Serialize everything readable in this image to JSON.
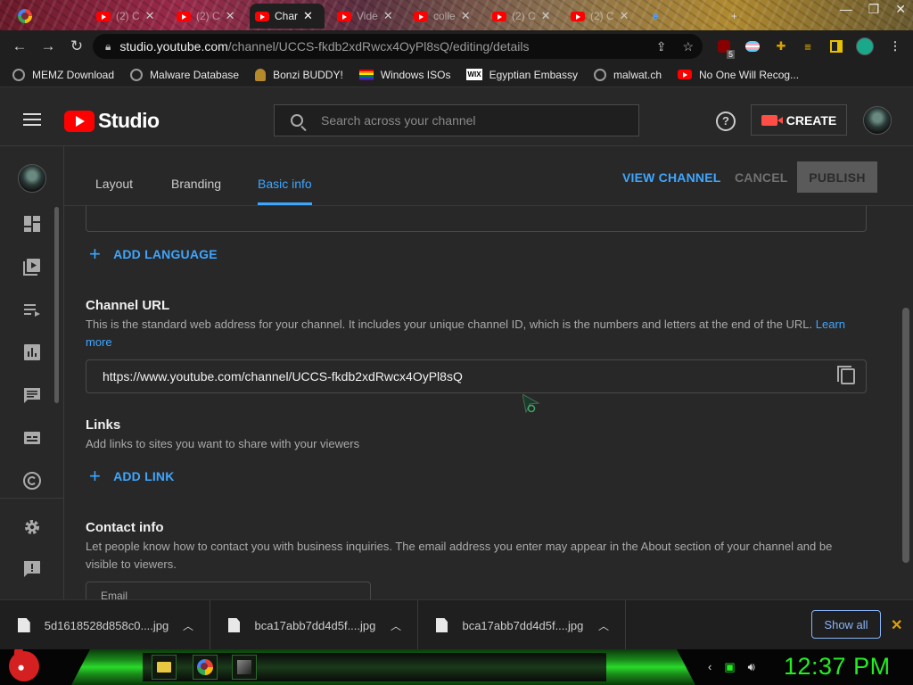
{
  "browser": {
    "tabs": [
      {
        "label": "",
        "icon": "google-icon"
      },
      {
        "label": "(2) C",
        "icon": "youtube-icon"
      },
      {
        "label": "(2) C",
        "icon": "youtube-icon"
      },
      {
        "label": "Char",
        "icon": "youtube-icon",
        "active": true
      },
      {
        "label": "Vide",
        "icon": "youtube-icon"
      },
      {
        "label": "colle",
        "icon": "youtube-icon"
      },
      {
        "label": "(2) C",
        "icon": "youtube-icon"
      },
      {
        "label": "(2) C",
        "icon": "youtube-icon"
      }
    ],
    "url_host": "studio.youtube.com",
    "url_path": "/channel/UCCS-fkdb2xdRwcx4OyPl8sQ/editing/details",
    "ext_badge": "5"
  },
  "bookmarks": [
    {
      "label": "MEMZ Download",
      "icon": "globe-icon"
    },
    {
      "label": "Malware Database",
      "icon": "globe-icon"
    },
    {
      "label": "Bonzi BUDDY!",
      "icon": "bonzi-icon"
    },
    {
      "label": "Windows ISOs",
      "icon": "rainbow-flag-icon"
    },
    {
      "label": "Egyptian Embassy",
      "icon": "wix-icon",
      "icon_text": "WIX"
    },
    {
      "label": "malwat.ch",
      "icon": "globe-icon"
    },
    {
      "label": "No One Will Recog...",
      "icon": "youtube-icon"
    }
  ],
  "studio": {
    "logo_text": "Studio",
    "search_placeholder": "Search across your channel",
    "help_glyph": "?",
    "create_label": "CREATE"
  },
  "tabs": {
    "layout": "Layout",
    "branding": "Branding",
    "basic_info": "Basic info",
    "view_channel": "VIEW CHANNEL",
    "cancel": "CANCEL",
    "publish": "PUBLISH"
  },
  "content": {
    "add_language": "ADD LANGUAGE",
    "channel_url_title": "Channel URL",
    "channel_url_desc": "This is the standard web address for your channel. It includes your unique channel ID, which is the numbers and letters at the end of the URL.",
    "learn_more": "Learn more",
    "channel_url_value": "https://www.youtube.com/channel/UCCS-fkdb2xdRwcx4OyPl8sQ",
    "links_title": "Links",
    "links_desc": "Add links to sites you want to share with your viewers",
    "add_link": "ADD LINK",
    "contact_title": "Contact info",
    "contact_desc": "Let people know how to contact you with business inquiries. The email address you enter may appear in the About section of your channel and be visible to viewers.",
    "email_label": "Email"
  },
  "downloads": {
    "items": [
      {
        "name": "5d1618528d858c0....jpg"
      },
      {
        "name": "bca17abb7dd4d5f....jpg"
      },
      {
        "name": "bca17abb7dd4d5f....jpg"
      }
    ],
    "show_all": "Show all"
  },
  "taskbar": {
    "clock": "12:37 PM"
  },
  "colors": {
    "accent_blue": "#3ea6ff",
    "youtube_red": "#ff0000",
    "clock_green": "#22ee22"
  }
}
